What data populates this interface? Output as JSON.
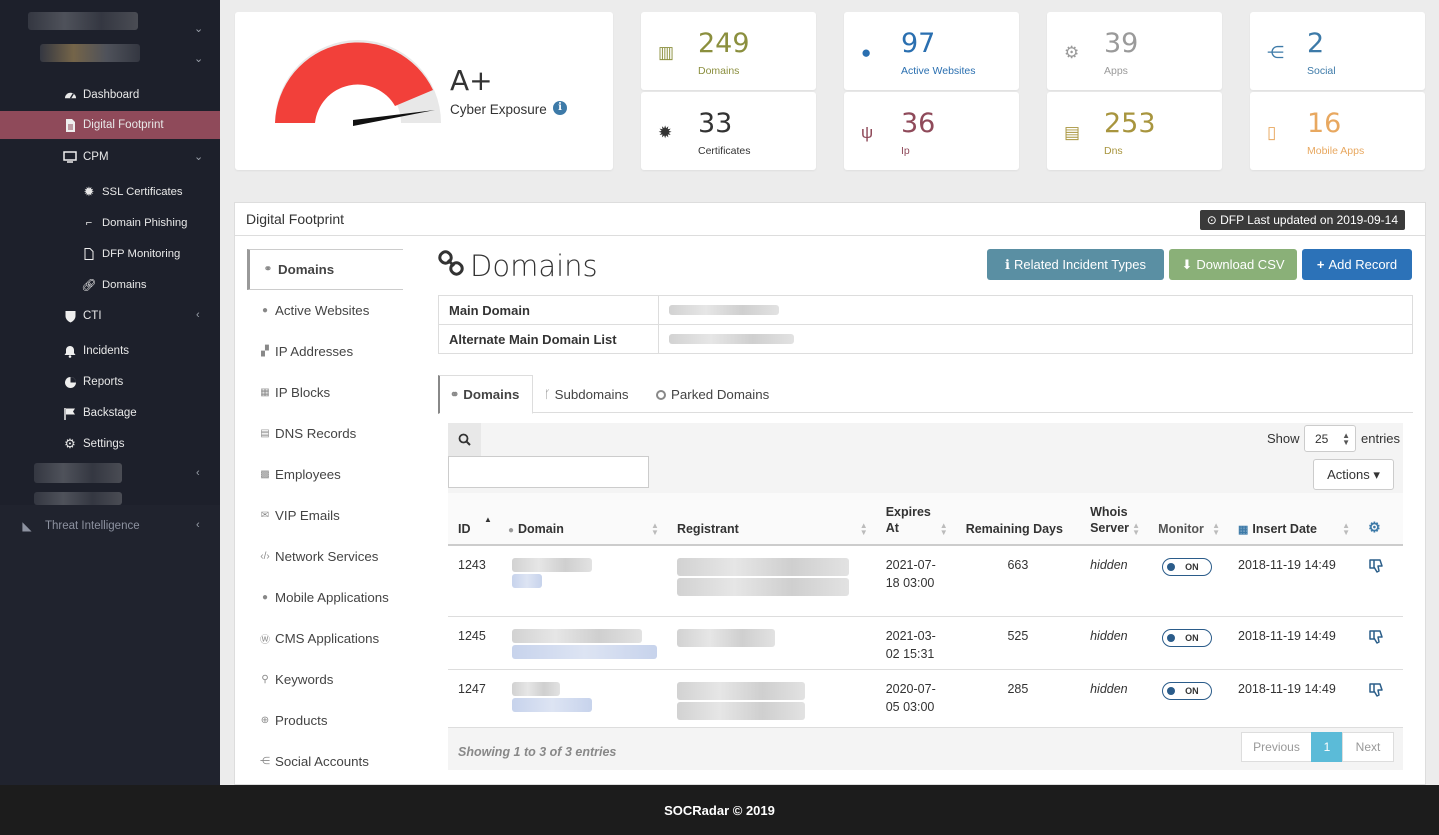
{
  "sidebar": {
    "items": [
      {
        "label": "Dashboard",
        "icon": "dashboard-icon"
      },
      {
        "label": "Digital Footprint",
        "icon": "file-icon"
      },
      {
        "label": "CPM",
        "icon": "monitor-icon"
      },
      {
        "label": "SSL Certificates",
        "icon": "gear-icon"
      },
      {
        "label": "Domain Phishing",
        "icon": "phishing-icon"
      },
      {
        "label": "DFP Monitoring",
        "icon": "file-icon"
      },
      {
        "label": "Domains",
        "icon": "link-icon"
      },
      {
        "label": "CTI",
        "icon": "shield-icon"
      },
      {
        "label": "Incidents",
        "icon": "bell-icon"
      },
      {
        "label": "Reports",
        "icon": "pie-icon"
      },
      {
        "label": "Backstage",
        "icon": "flag-icon"
      },
      {
        "label": "Settings",
        "icon": "gear-icon"
      }
    ],
    "threat_label": "Threat Intelligence"
  },
  "score": {
    "grade": "A+",
    "label": "Cyber Exposure"
  },
  "stats": [
    {
      "value": "249",
      "label": "Domains",
      "color": "#8b8f3e",
      "icon": "building-icon"
    },
    {
      "value": "97",
      "label": "Active Websites",
      "color": "#2a6fb0",
      "icon": "globe-icon"
    },
    {
      "value": "39",
      "label": "Apps",
      "color": "#9a9a9a",
      "icon": "cogs-icon"
    },
    {
      "value": "2",
      "label": "Social",
      "color": "#3d7aa8",
      "icon": "share-icon"
    },
    {
      "value": "33",
      "label": "Certificates",
      "color": "#333333",
      "icon": "certificate-icon"
    },
    {
      "value": "36",
      "label": "Ip",
      "color": "#8f4a5a",
      "icon": "fork-icon"
    },
    {
      "value": "253",
      "label": "Dns",
      "color": "#a8953e",
      "icon": "newspaper-icon"
    },
    {
      "value": "16",
      "label": "Mobile Apps",
      "color": "#e8a860",
      "icon": "mobile-icon"
    }
  ],
  "panel": {
    "title": "Digital Footprint",
    "badge": "⊙ DFP Last updated on 2019-09-14",
    "heading": "Domains",
    "buttons": {
      "incident": "Related Incident Types",
      "csv": "Download CSV",
      "add": "Add Record"
    },
    "kv": [
      {
        "key": "Main Domain"
      },
      {
        "key": "Alternate Main Domain List"
      }
    ],
    "leftnav": [
      "Domains",
      "Active Websites",
      "IP Addresses",
      "IP Blocks",
      "DNS Records",
      "Employees",
      "VIP Emails",
      "Network Services",
      "Mobile Applications",
      "CMS Applications",
      "Keywords",
      "Products",
      "Social Accounts"
    ],
    "tabs": [
      "Domains",
      "Subdomains",
      "Parked Domains"
    ]
  },
  "table": {
    "show_label": "Show",
    "entries_label": "entries",
    "page_size": "25",
    "actions": "Actions ▾",
    "columns": [
      "ID",
      "Domain",
      "Registrant",
      "Expires At",
      "Remaining Days",
      "Whois Server",
      "Monitor",
      "Insert Date"
    ],
    "rows": [
      {
        "id": "1243",
        "expires": "2021-07-18 03:00",
        "days": "663",
        "whois": "hidden",
        "monitor": "ON",
        "insert": "2018-11-19 14:49"
      },
      {
        "id": "1245",
        "expires": "2021-03-02 15:31",
        "days": "525",
        "whois": "hidden",
        "monitor": "ON",
        "insert": "2018-11-19 14:49"
      },
      {
        "id": "1247",
        "expires": "2020-07-05 03:00",
        "days": "285",
        "whois": "hidden",
        "monitor": "ON",
        "insert": "2018-11-19 14:49"
      }
    ],
    "summary": "Showing 1 to 3 of 3 entries",
    "prev": "Previous",
    "page": "1",
    "next": "Next"
  },
  "footer": "SOCRadar © 2019"
}
